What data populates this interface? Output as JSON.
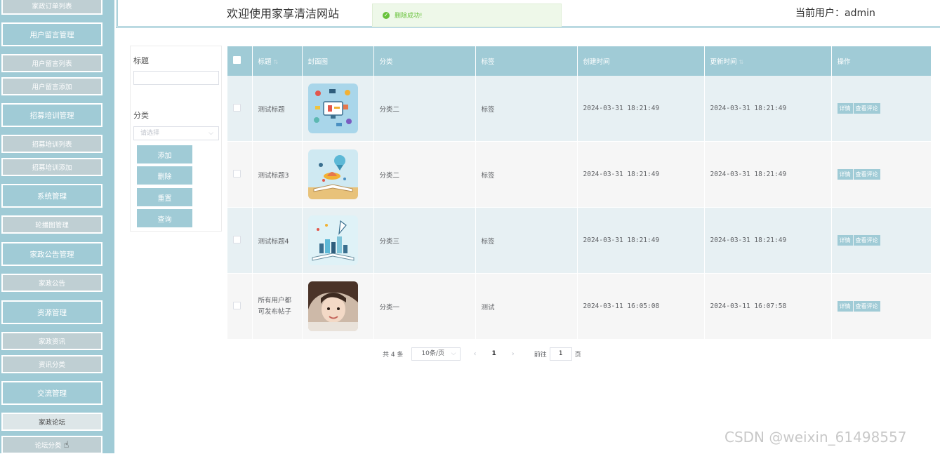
{
  "sidebar": {
    "items": [
      {
        "label": "家政订单列表",
        "type": "sub"
      },
      {
        "label": "用户留言管理",
        "type": "group"
      },
      {
        "label": "用户留言列表",
        "type": "sub"
      },
      {
        "label": "用户留言添加",
        "type": "sub"
      },
      {
        "label": "招募培训管理",
        "type": "group"
      },
      {
        "label": "招募培训列表",
        "type": "sub"
      },
      {
        "label": "招募培训添加",
        "type": "sub"
      },
      {
        "label": "系统管理",
        "type": "group"
      },
      {
        "label": "轮播图管理",
        "type": "sub"
      },
      {
        "label": "家政公告管理",
        "type": "group"
      },
      {
        "label": "家政公告",
        "type": "sub"
      },
      {
        "label": "资源管理",
        "type": "group"
      },
      {
        "label": "家政资讯",
        "type": "sub"
      },
      {
        "label": "资讯分类",
        "type": "sub"
      },
      {
        "label": "交流管理",
        "type": "group"
      },
      {
        "label": "家政论坛",
        "type": "sub",
        "active": true
      },
      {
        "label": "论坛分类",
        "type": "sub"
      }
    ]
  },
  "header": {
    "title": "欢迎使用家享清洁网站",
    "user_label": "当前用户：admin"
  },
  "toast": {
    "message": "删除成功!",
    "color": "#67c23a"
  },
  "search": {
    "title_label": "标题",
    "title_value": "",
    "category_label": "分类",
    "category_placeholder": "请选择",
    "buttons": {
      "add": "添加",
      "delete": "删除",
      "reset": "重置",
      "query": "查询"
    }
  },
  "table": {
    "headers": {
      "title": "标题",
      "cover": "封面图",
      "category": "分类",
      "tag": "标签",
      "created": "创建时间",
      "updated": "更新时间",
      "actions": "操作"
    },
    "rows": [
      {
        "title": "测试标题",
        "category": "分类二",
        "tag": "标签",
        "created": "2024-03-31 18:21:49",
        "updated": "2024-03-31 18:21:49",
        "cover": "illustration of floating tech icons around a monitor"
      },
      {
        "title": "测试标题3",
        "category": "分类二",
        "tag": "标签",
        "created": "2024-03-31 18:21:49",
        "updated": "2024-03-31 18:21:49",
        "cover": "open book with hot air balloon and hat illustration"
      },
      {
        "title": "测试标题4",
        "category": "分类三",
        "tag": "标签",
        "created": "2024-03-31 18:21:49",
        "updated": "2024-03-31 18:21:49",
        "cover": "open book with city and rocket illustration"
      },
      {
        "title": "所有用户都可发布帖子",
        "category": "分类一",
        "tag": "测试",
        "created": "2024-03-11 16:05:08",
        "updated": "2024-03-11 16:07:58",
        "cover": "photo of a smiling girl"
      }
    ],
    "action_labels": {
      "detail": "详情",
      "comments": "查看评论"
    }
  },
  "pagination": {
    "total": "共 4 条",
    "page_size": "10条/页",
    "current_page": "1",
    "goto_label": "前往",
    "goto_value": "1",
    "page_unit": "页"
  },
  "watermark": "CSDN @weixin_61498557",
  "colors": {
    "accent": "#a0cbd6",
    "success": "#67c23a"
  }
}
